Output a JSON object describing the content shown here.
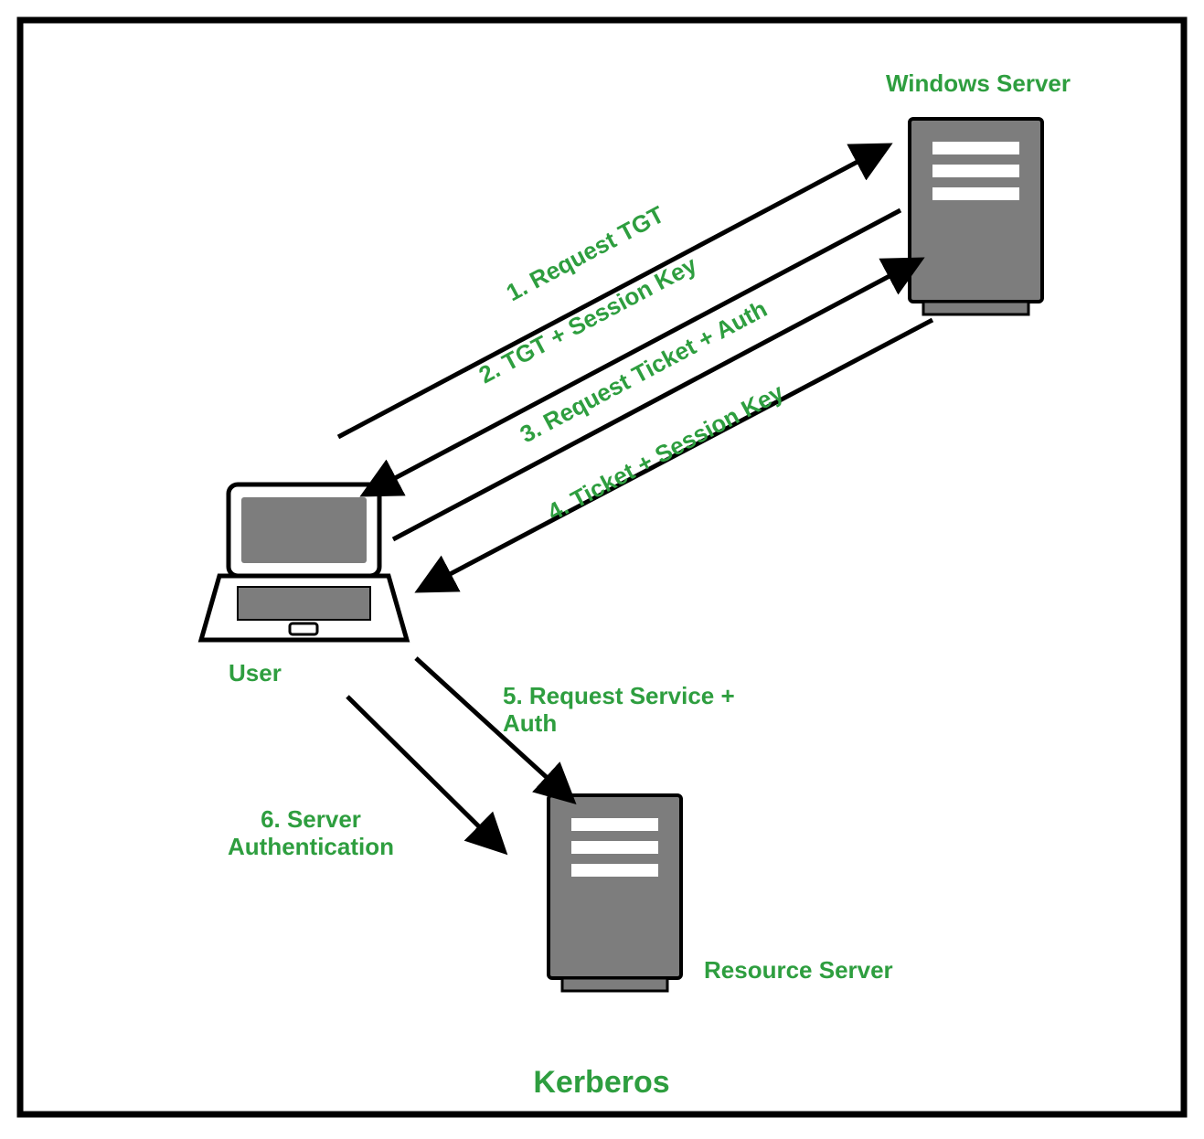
{
  "title": "Kerberos",
  "nodes": {
    "user": "User",
    "windows_server": "Windows Server",
    "resource_server": "Resource Server"
  },
  "steps": {
    "s1": "1. Request TGT",
    "s2": "2. TGT + Session Key",
    "s3": "3. Request Ticket + Auth",
    "s4": "4. Ticket + Session Key",
    "s5a": "5. Request Service +",
    "s5b": "Auth",
    "s6a": "6. Server",
    "s6b": "Authentication"
  }
}
